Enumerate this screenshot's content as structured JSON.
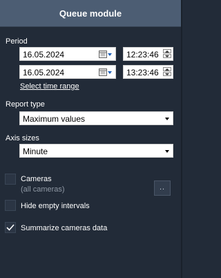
{
  "header": {
    "title": "Queue module"
  },
  "period": {
    "label": "Period",
    "from": {
      "date": "16.05.2024",
      "time": "12:23:46"
    },
    "to": {
      "date": "16.05.2024",
      "time": "13:23:46"
    },
    "select_range_link": "Select time range"
  },
  "report_type": {
    "label": "Report type",
    "value": "Maximum values"
  },
  "axis_sizes": {
    "label": "Axis sizes",
    "value": "Minute"
  },
  "cameras": {
    "label": "Cameras",
    "sublabel": "(all cameras)",
    "checked": false,
    "more_button": ".."
  },
  "hide_empty": {
    "label": "Hide empty intervals",
    "checked": false
  },
  "summarize": {
    "label": "Summarize cameras data",
    "checked": true
  },
  "colors": {
    "background": "#222b38",
    "header": "#4c5d73",
    "checkbox_bg": "#2b3544"
  },
  "icons": [
    "calendar-icon",
    "chevron-down-icon",
    "spin-up-icon",
    "spin-down-icon",
    "checkmark-icon"
  ]
}
